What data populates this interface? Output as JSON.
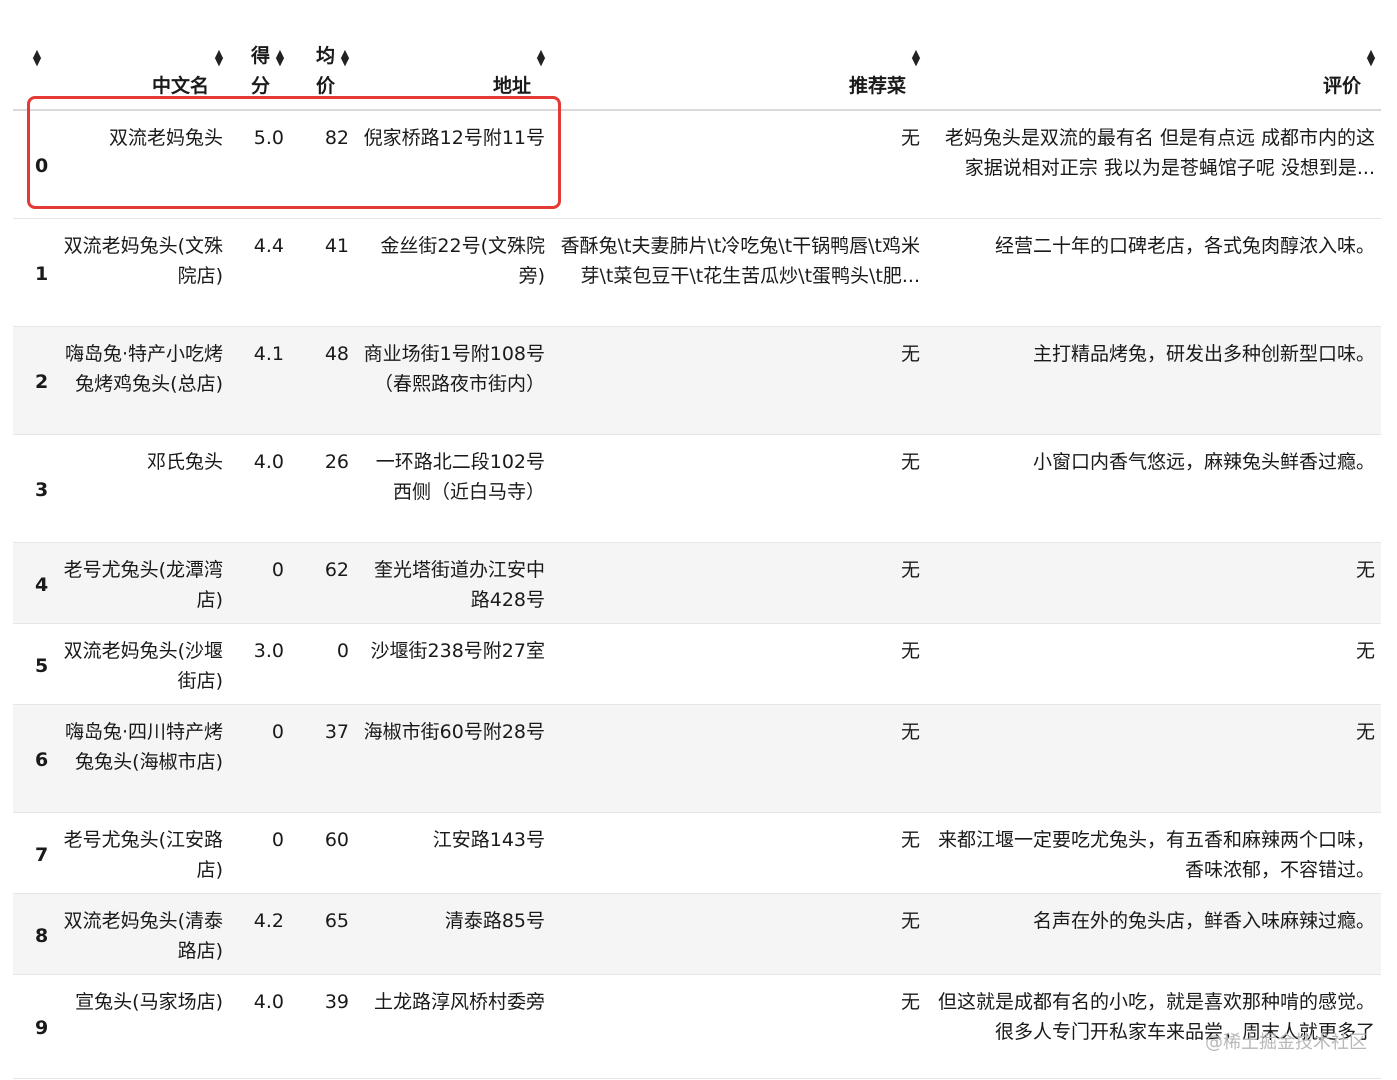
{
  "headers": {
    "index": "",
    "name": "中文名",
    "score_line1": "得",
    "score_line2": "分",
    "price_line1": "均",
    "price_line2": "价",
    "address": "地址",
    "dishes": "推荐菜",
    "review": "评价"
  },
  "rows": [
    {
      "index": "0",
      "name": "双流老妈兔头",
      "score": "5.0",
      "price": "82",
      "address": "倪家桥路12号附11号",
      "dishes": "无",
      "review": "老妈兔头是双流的最有名 但是有点远 成都市内的这家据说相对正宗 我以为是苍蝇馆子呢 没想到是..."
    },
    {
      "index": "1",
      "name": "双流老妈兔头(文殊院店)",
      "score": "4.4",
      "price": "41",
      "address": "金丝街22号(文殊院旁)",
      "dishes": "香酥兔\\t夫妻肺片\\t冷吃兔\\t干锅鸭唇\\t鸡米芽\\t菜包豆干\\t花生苦瓜炒\\t蛋鸭头\\t肥...",
      "review": "经营二十年的口碑老店，各式兔肉醇浓入味。"
    },
    {
      "index": "2",
      "name": "嗨岛兔·特产小吃烤兔烤鸡兔头(总店)",
      "score": "4.1",
      "price": "48",
      "address": "商业场街1号附108号（春熙路夜市街内）",
      "dishes": "无",
      "review": "主打精品烤兔，研发出多种创新型口味。"
    },
    {
      "index": "3",
      "name": "邓氏兔头",
      "score": "4.0",
      "price": "26",
      "address": "一环路北二段102号西侧（近白马寺）",
      "dishes": "无",
      "review": "小窗口内香气悠远，麻辣兔头鲜香过瘾。"
    },
    {
      "index": "4",
      "name": "老号尤兔头(龙潭湾店)",
      "score": "0",
      "price": "62",
      "address": "奎光塔街道办江安中路428号",
      "dishes": "无",
      "review": "无"
    },
    {
      "index": "5",
      "name": "双流老妈兔头(沙堰街店)",
      "score": "3.0",
      "price": "0",
      "address": "沙堰街238号附27室",
      "dishes": "无",
      "review": "无"
    },
    {
      "index": "6",
      "name": "嗨岛兔·四川特产烤兔兔头(海椒市店)",
      "score": "0",
      "price": "37",
      "address": "海椒市街60号附28号",
      "dishes": "无",
      "review": "无"
    },
    {
      "index": "7",
      "name": "老号尤兔头(江安路店)",
      "score": "0",
      "price": "60",
      "address": "江安路143号",
      "dishes": "无",
      "review": "来都江堰一定要吃尤兔头，有五香和麻辣两个口味，香味浓郁，不容错过。"
    },
    {
      "index": "8",
      "name": "双流老妈兔头(清泰路店)",
      "score": "4.2",
      "price": "65",
      "address": "清泰路85号",
      "dishes": "无",
      "review": "名声在外的兔头店，鲜香入味麻辣过瘾。"
    },
    {
      "index": "9",
      "name": "宣兔头(马家场店)",
      "score": "4.0",
      "price": "39",
      "address": "土龙路淳风桥村委旁",
      "dishes": "无",
      "review": "但这就是成都有名的小吃，就是喜欢那种啃的感觉。很多人专门开私家车来品尝，周末人就更多了"
    }
  ],
  "watermark": "@稀土掘金技术社区",
  "colors": {
    "highlight": "#e53935",
    "stripe": "#f5f5f5"
  },
  "icons": {
    "sort": "sort-arrows-icon"
  }
}
